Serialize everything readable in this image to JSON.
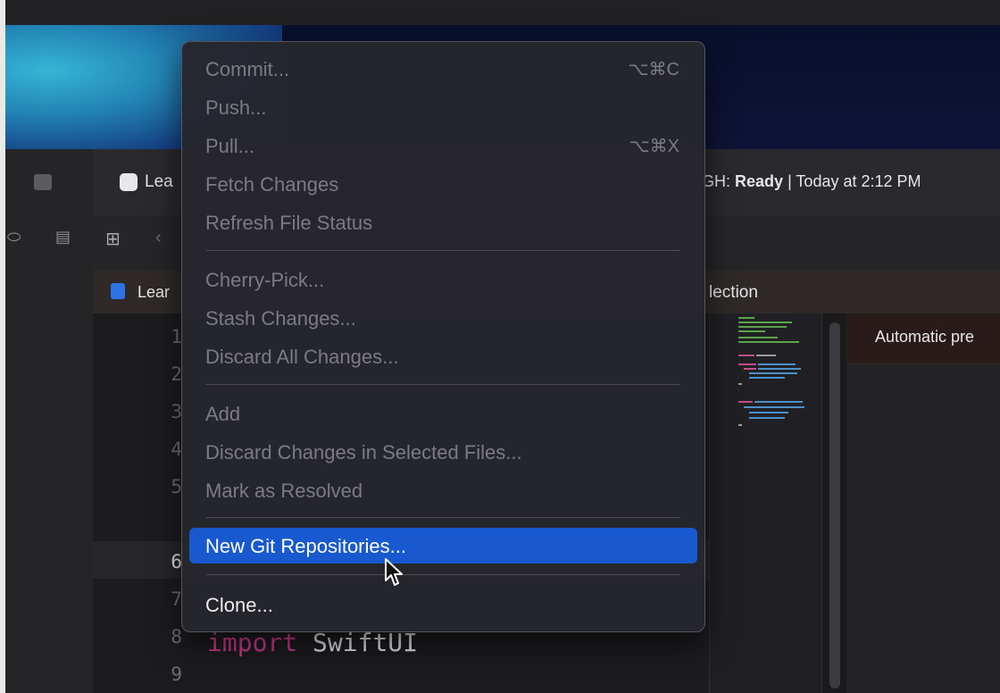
{
  "xcode": {
    "tab_label": "Lea",
    "status_prefix": "GH:",
    "status_state": "Ready",
    "status_time": "| Today at 2:12 PM",
    "jump_file_label": "Lear",
    "jump_right_label": "lection",
    "preview_label": "Automatic pre"
  },
  "editor": {
    "line_numbers": [
      "1",
      "2",
      "3",
      "4",
      "5",
      "6",
      "7",
      "8",
      "9"
    ],
    "current_line": "6",
    "code_keyword": "import",
    "code_module": " SwiftUI"
  },
  "menu": {
    "items": [
      {
        "label": "Commit...",
        "shortcut": "⌥⌘C",
        "enabled": false
      },
      {
        "label": "Push...",
        "shortcut": "",
        "enabled": false
      },
      {
        "label": "Pull...",
        "shortcut": "⌥⌘X",
        "enabled": false
      },
      {
        "label": "Fetch Changes",
        "shortcut": "",
        "enabled": false
      },
      {
        "label": "Refresh File Status",
        "shortcut": "",
        "enabled": false
      },
      {
        "label": "Cherry-Pick...",
        "shortcut": "",
        "enabled": false
      },
      {
        "label": "Stash Changes...",
        "shortcut": "",
        "enabled": false
      },
      {
        "label": "Discard All Changes...",
        "shortcut": "",
        "enabled": false
      },
      {
        "label": "Add",
        "shortcut": "",
        "enabled": false
      },
      {
        "label": "Discard Changes in Selected Files...",
        "shortcut": "",
        "enabled": false
      },
      {
        "label": "Mark as Resolved",
        "shortcut": "",
        "enabled": false
      },
      {
        "label": "New Git Repositories...",
        "shortcut": "",
        "enabled": true,
        "highlighted": true
      },
      {
        "label": "Clone...",
        "shortcut": "",
        "enabled": true
      }
    ]
  },
  "colors": {
    "menu_highlight": "#1859cf",
    "keyword": "#d13b8d",
    "disabled_text": "#7b7b82"
  },
  "icons": [
    "sidebar-square-icon",
    "tag-icon",
    "list-icon",
    "grid-icon",
    "back-chevron-icon",
    "swift-file-icon",
    "mouse-pointer-icon"
  ]
}
